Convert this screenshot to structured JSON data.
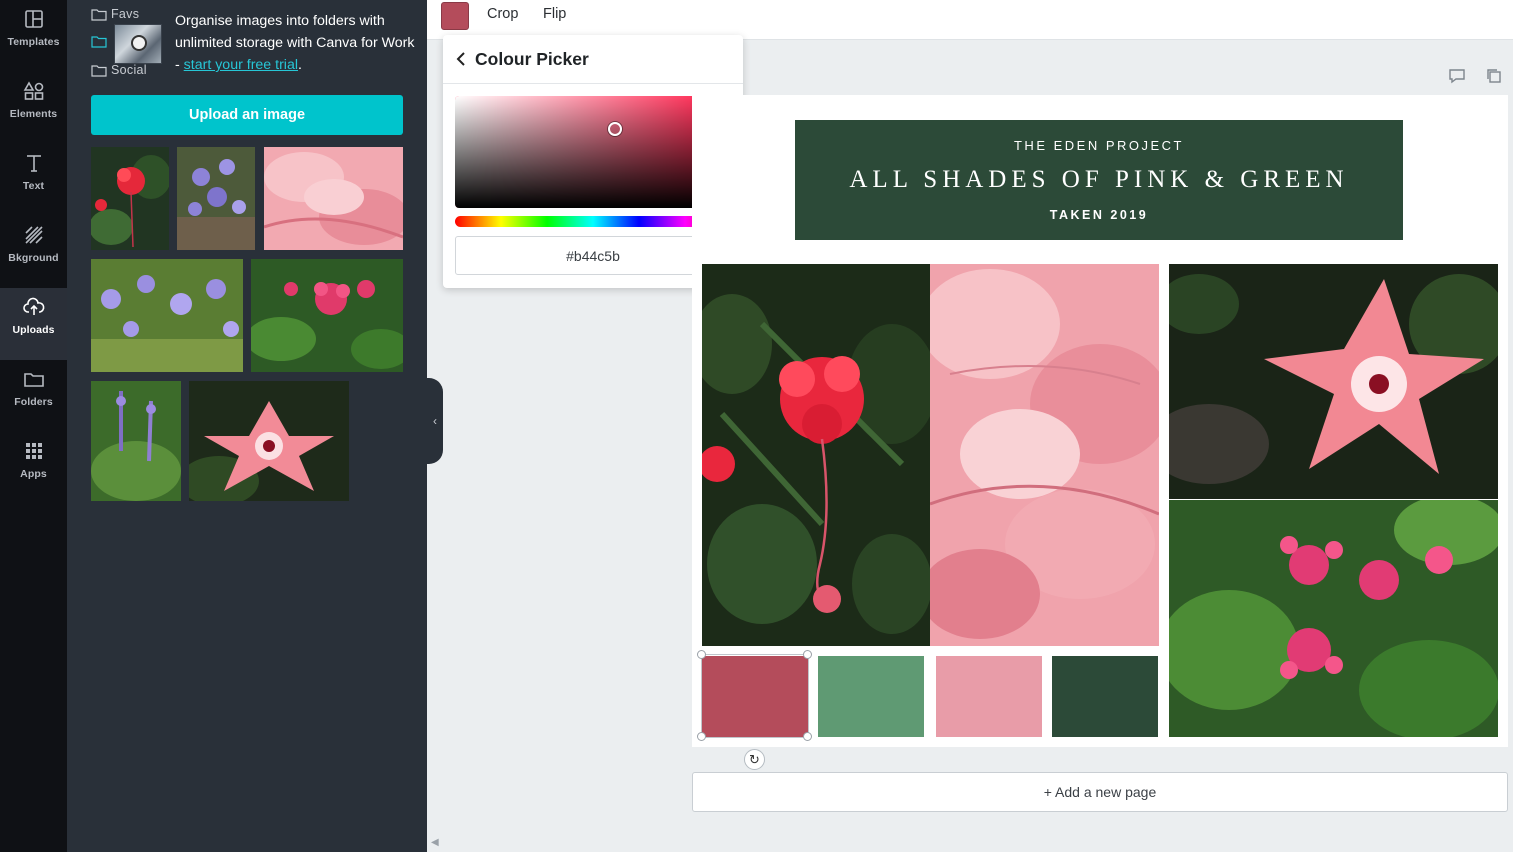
{
  "sidebar": {
    "items": [
      {
        "label": "Templates",
        "icon": "templates-icon"
      },
      {
        "label": "Elements",
        "icon": "elements-icon"
      },
      {
        "label": "Text",
        "icon": "text-icon"
      },
      {
        "label": "Bkground",
        "icon": "background-icon"
      },
      {
        "label": "Uploads",
        "icon": "uploads-icon",
        "active": true
      },
      {
        "label": "Folders",
        "icon": "folder-icon"
      },
      {
        "label": "Apps",
        "icon": "apps-icon"
      }
    ]
  },
  "uploads_panel": {
    "folders": [
      "Favs",
      "Social"
    ],
    "promo": {
      "text": "Organise images into folders with unlimited storage with Canva for Work - ",
      "link": "start your free trial",
      "suffix": "."
    },
    "upload_button": "Upload an image",
    "thumbnails": [
      "red-flower",
      "purple-flowers",
      "pink-petals",
      "blue-wildflowers",
      "pink-cluster",
      "purple-spikes",
      "hibiscus"
    ]
  },
  "toolbar": {
    "swatch_color": "#b44c5b",
    "crop_label": "Crop",
    "flip_label": "Flip"
  },
  "colour_picker": {
    "title": "Colour Picker",
    "hue_color": "#ff1744",
    "hex_value": "#b44c5b"
  },
  "canvas": {
    "banner": {
      "kicker": "THE EDEN PROJECT",
      "title": "ALL SHADES OF PINK & GREEN",
      "subtitle": "TAKEN 2019",
      "bg_color": "#2c4a38"
    },
    "palette": [
      "#b44c5b",
      "#5f9a73",
      "#e89ca8",
      "#2c4a38"
    ],
    "add_page_label": "+ Add a new page"
  }
}
